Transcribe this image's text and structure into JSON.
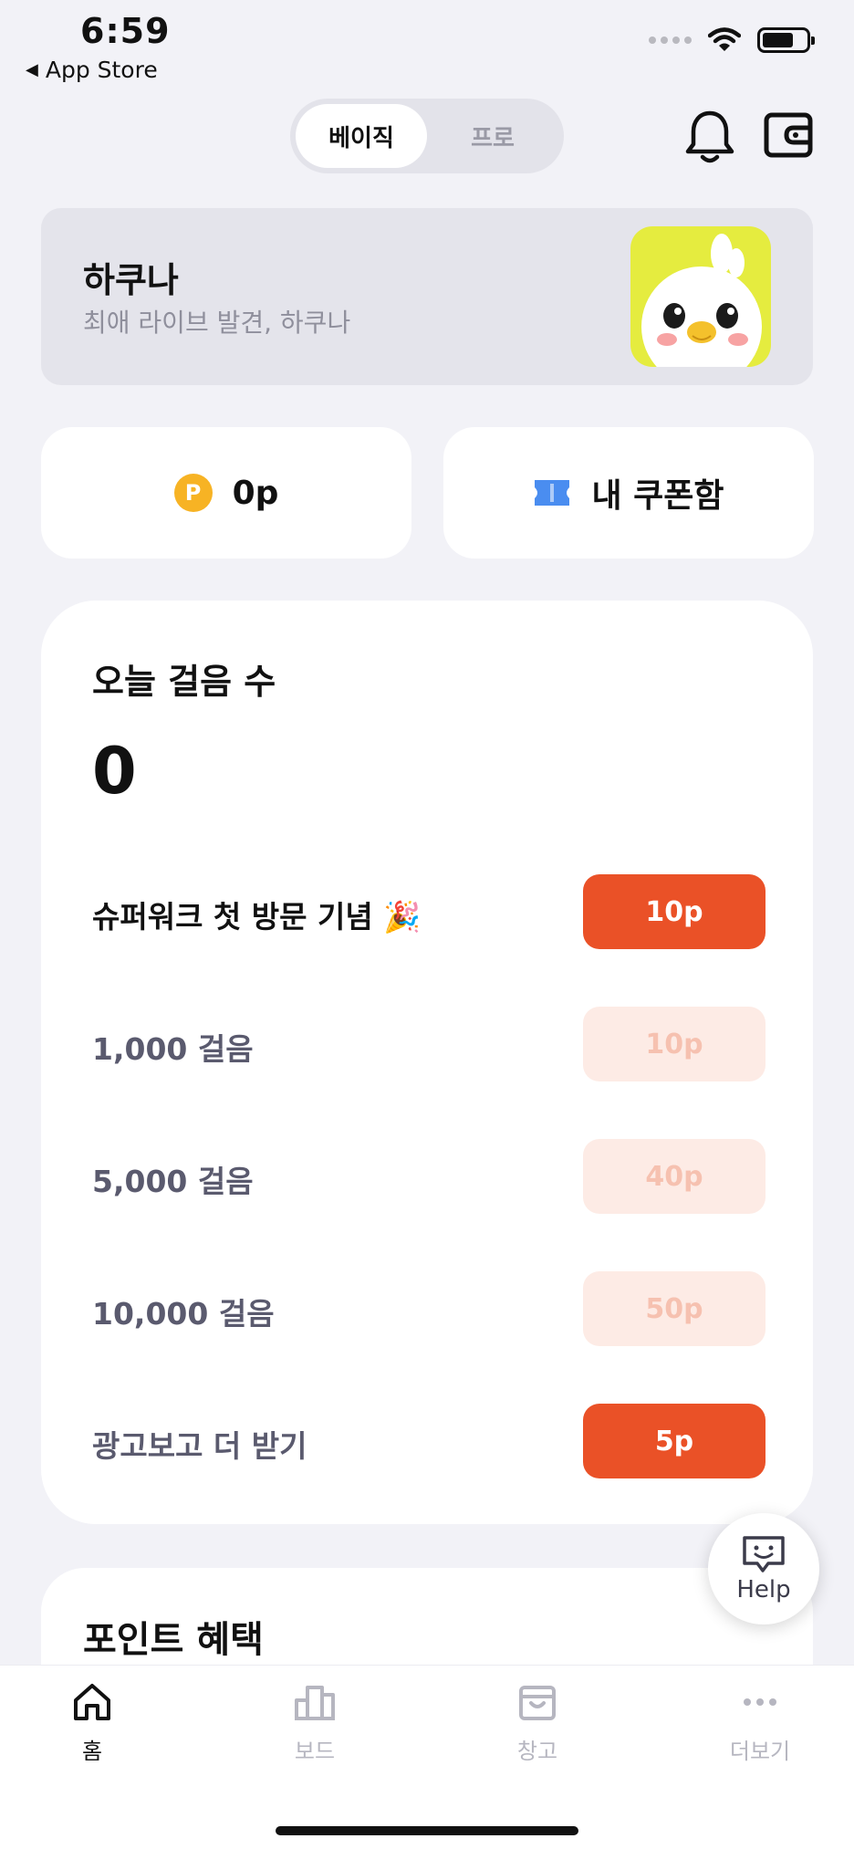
{
  "status_bar": {
    "time": "6:59",
    "back_label": "App Store"
  },
  "header": {
    "segments": [
      {
        "label": "베이직",
        "active": true
      },
      {
        "label": "프로",
        "active": false
      }
    ],
    "bell_icon": "bell-icon",
    "wallet_icon": "wallet-icon"
  },
  "banner": {
    "title": "하쿠나",
    "subtitle": "최애 라이브 발견, 하쿠나",
    "image": "duck-mascot"
  },
  "points_card": {
    "icon": "point-coin-icon",
    "coin_letter": "P",
    "label": "0p"
  },
  "coupon_card": {
    "icon": "ticket-icon",
    "label": "내 쿠폰함"
  },
  "steps": {
    "title": "오늘 걸음 수",
    "count": "0",
    "rows": [
      {
        "label": "슈퍼워크 첫 방문 기념 🎉",
        "reward": "10p",
        "enabled": true
      },
      {
        "label": "1,000 걸음",
        "reward": "10p",
        "enabled": false
      },
      {
        "label": "5,000 걸음",
        "reward": "40p",
        "enabled": false
      },
      {
        "label": "10,000 걸음",
        "reward": "50p",
        "enabled": false
      },
      {
        "label": "광고보고 더 받기",
        "reward": "5p",
        "enabled": true
      }
    ]
  },
  "benefits": {
    "title": "포인트 혜택"
  },
  "help": {
    "label": "Help",
    "icon": "chat-smile-icon"
  },
  "tabbar": {
    "tabs": [
      {
        "label": "홈",
        "icon": "home-icon",
        "active": true
      },
      {
        "label": "보드",
        "icon": "leaderboard-icon",
        "active": false
      },
      {
        "label": "창고",
        "icon": "bag-icon",
        "active": false
      },
      {
        "label": "더보기",
        "icon": "more-icon",
        "active": false
      }
    ]
  },
  "colors": {
    "accent": "#ea5127",
    "accent_light": "#fdebe5",
    "background": "#f2f2f7",
    "coin": "#f7b324",
    "ticket": "#4a8df0"
  }
}
